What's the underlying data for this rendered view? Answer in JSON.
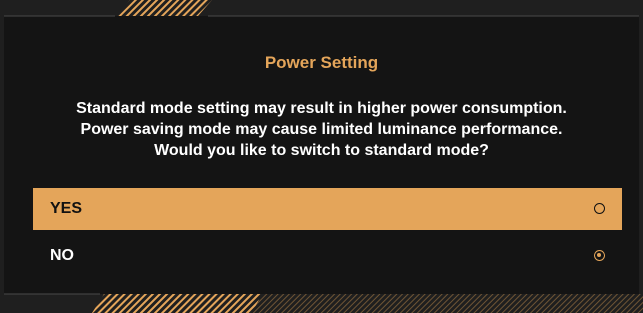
{
  "dialog": {
    "title": "Power Setting",
    "message_lines": [
      "Standard mode setting may result in higher power consumption.",
      "Power saving mode may cause limited luminance performance.",
      "Would you like to switch to standard mode?"
    ],
    "options": [
      {
        "label": "YES",
        "highlighted": true,
        "checked": false
      },
      {
        "label": "NO",
        "highlighted": false,
        "checked": true
      }
    ]
  },
  "colors": {
    "accent": "#e4a55a",
    "background": "#141414",
    "frame": "#1f1f1f",
    "text": "#ffffff"
  },
  "icons": {
    "radio_unchecked": "radio-empty-icon",
    "radio_checked": "radio-filled-icon"
  }
}
